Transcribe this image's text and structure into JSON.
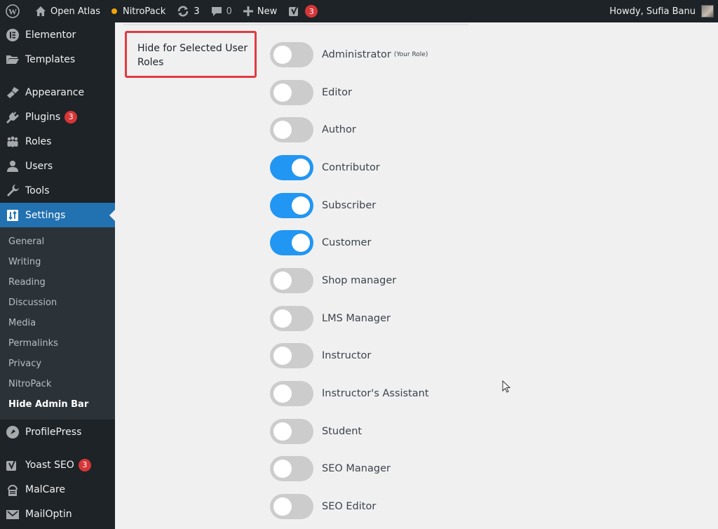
{
  "adminbar": {
    "wp_logo": "wordpress-icon",
    "site_name": "Open Atlas",
    "nitropack": "NitroPack",
    "updates_count": "3",
    "comments_count": "0",
    "new_label": "New",
    "yoast_badge": "3",
    "greeting": "Howdy, Sufia Banu"
  },
  "sidebar": {
    "items_top": [
      {
        "label": "Elementor",
        "icon": "elementor-icon"
      },
      {
        "label": "Templates",
        "icon": "folder-icon"
      }
    ],
    "items_mid": [
      {
        "label": "Appearance",
        "icon": "brush-icon"
      },
      {
        "label": "Plugins",
        "icon": "plug-icon",
        "badge": "3"
      },
      {
        "label": "Roles",
        "icon": "group-icon"
      },
      {
        "label": "Users",
        "icon": "user-icon"
      },
      {
        "label": "Tools",
        "icon": "wrench-icon"
      },
      {
        "label": "Settings",
        "icon": "settings-icon",
        "current": true
      }
    ],
    "settings_submenu": [
      {
        "label": "General"
      },
      {
        "label": "Writing"
      },
      {
        "label": "Reading"
      },
      {
        "label": "Discussion"
      },
      {
        "label": "Media"
      },
      {
        "label": "Permalinks"
      },
      {
        "label": "Privacy"
      },
      {
        "label": "NitroPack"
      },
      {
        "label": "Hide Admin Bar",
        "active": true
      }
    ],
    "items_bottom": [
      {
        "label": "ProfilePress",
        "icon": "profilepress-icon"
      },
      {
        "label": "Yoast SEO",
        "icon": "yoast-icon",
        "badge": "3"
      },
      {
        "label": "MalCare",
        "icon": "malcare-icon"
      },
      {
        "label": "MailOptin",
        "icon": "mail-icon"
      }
    ]
  },
  "main": {
    "section_label": "Hide for Selected User Roles",
    "roles": [
      {
        "label": "Administrator",
        "note": "(Your Role)",
        "enabled": false
      },
      {
        "label": "Editor",
        "enabled": false
      },
      {
        "label": "Author",
        "enabled": false
      },
      {
        "label": "Contributor",
        "enabled": true
      },
      {
        "label": "Subscriber",
        "enabled": true
      },
      {
        "label": "Customer",
        "enabled": true
      },
      {
        "label": "Shop manager",
        "enabled": false
      },
      {
        "label": "LMS Manager",
        "enabled": false
      },
      {
        "label": "Instructor",
        "enabled": false
      },
      {
        "label": "Instructor's Assistant",
        "enabled": false
      },
      {
        "label": "Student",
        "enabled": false
      },
      {
        "label": "SEO Manager",
        "enabled": false
      },
      {
        "label": "SEO Editor",
        "enabled": false
      }
    ]
  },
  "colors": {
    "admin_bg": "#1d2327",
    "accent": "#2271b1",
    "toggle_on": "#2196f3",
    "toggle_off": "#cccccc",
    "badge": "#d63638",
    "highlight_border": "#e23b40"
  }
}
